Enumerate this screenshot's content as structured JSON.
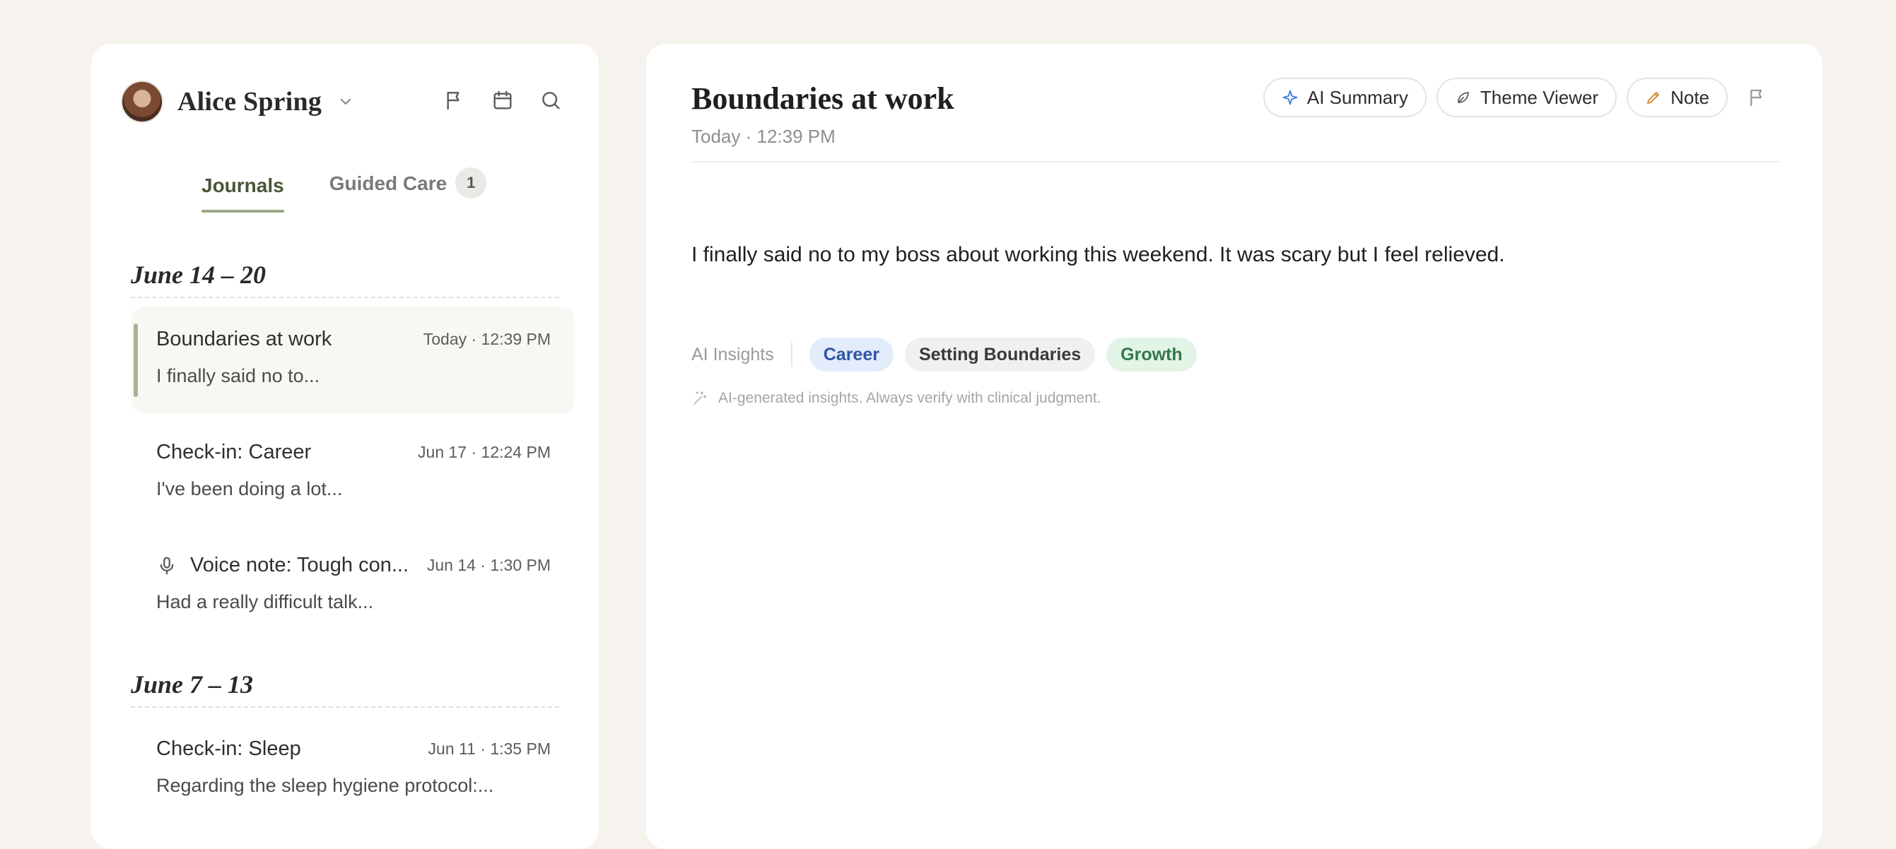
{
  "sidebar": {
    "user_name": "Alice Spring",
    "tabs": [
      {
        "label": "Journals",
        "active": true
      },
      {
        "label": "Guided Care",
        "badge": "1"
      }
    ],
    "groups": [
      {
        "heading": "June 14 – 20",
        "entries": [
          {
            "title": "Boundaries at work",
            "date": "Today · 12:39 PM",
            "preview": "I finally said no to...",
            "selected": true
          },
          {
            "title": "Check-in: Career",
            "date": "Jun 17 · 12:24 PM",
            "preview": "I've been doing a lot..."
          },
          {
            "title": "Voice note: Tough con...",
            "date": "Jun 14 · 1:30 PM",
            "preview": "Had a really difficult talk...",
            "icon": "microphone-icon"
          }
        ]
      },
      {
        "heading": "June 7 – 13",
        "entries": [
          {
            "title": "Check-in: Sleep",
            "date": "Jun 11 · 1:35 PM",
            "preview": "Regarding the sleep hygiene protocol:..."
          }
        ]
      }
    ]
  },
  "main": {
    "title": "Boundaries at work",
    "date": "Today · 12:39 PM",
    "actions": {
      "ai_summary": "AI Summary",
      "theme_viewer": "Theme Viewer",
      "note": "Note"
    },
    "body": "I finally said no to my boss about working this weekend. It was scary but I feel relieved.",
    "insights": {
      "label": "AI Insights",
      "tags": [
        "Career",
        "Setting Boundaries",
        "Growth"
      ],
      "disclaimer": "AI-generated insights. Always verify with clinical judgment."
    }
  },
  "colors": {
    "background": "#f6f3ee",
    "accent_green": "#495638",
    "tab_underline": "#9aa986",
    "tag_career": "#e3ecfb",
    "tag_growth": "#e2f4e6"
  }
}
